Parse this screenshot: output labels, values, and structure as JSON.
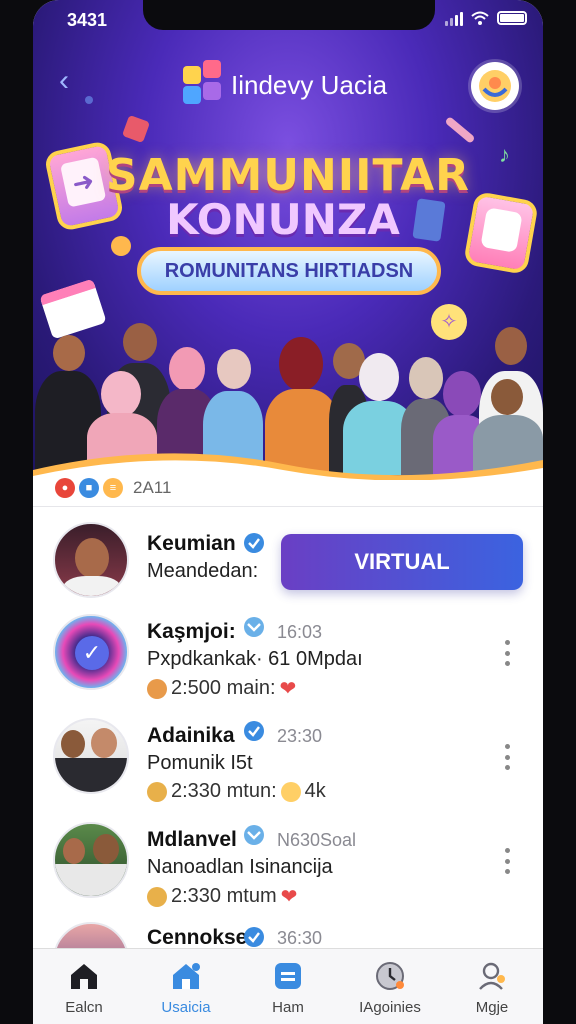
{
  "status_bar": {
    "time": "3431"
  },
  "header": {
    "title": "Iindevy Uacia"
  },
  "hero": {
    "headline_1": "SAMMUNIITAR",
    "headline_2": "KONUNZA",
    "banner": "ROMUNITANS HIRTIADSN"
  },
  "meta": {
    "count": "2A11"
  },
  "feed": [
    {
      "name": "Keumian",
      "subtitle": "Meandedan:",
      "action_label": "VIRTUAL"
    },
    {
      "name": "Kaşmjoi:",
      "time": "16:03",
      "subtitle": "Pxpdkankak· 61 0Mpdaı",
      "stat": "2:500 main:"
    },
    {
      "name": "Adainika",
      "time": "23:30",
      "subtitle": "Pomunik I5t",
      "stat": "2:330 mtun:",
      "stat_extra": "4k"
    },
    {
      "name": "Mdlanvel",
      "time": "N630Soal",
      "subtitle": "Nanoadlan Isinancija",
      "stat": "2:330 mtum"
    },
    {
      "name": "Cennokse",
      "time": "36:30"
    }
  ],
  "tabs": [
    {
      "label": "Ealcn",
      "icon": "home-icon"
    },
    {
      "label": "Usaicia",
      "icon": "community-home-icon"
    },
    {
      "label": "Ham",
      "icon": "list-icon"
    },
    {
      "label": "IAgoinies",
      "icon": "clock-icon"
    },
    {
      "label": "Mgje",
      "icon": "profile-icon"
    }
  ],
  "colors": {
    "accent": "#3a8be0",
    "hero_bg": "#4a2ab8",
    "button_start": "#6a3fc4",
    "button_end": "#3b63e0"
  }
}
